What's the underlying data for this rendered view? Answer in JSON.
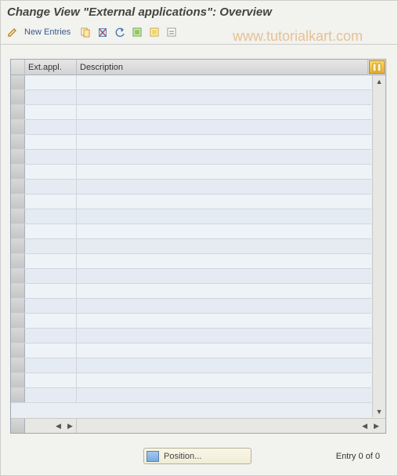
{
  "title": "Change View \"External applications\": Overview",
  "toolbar": {
    "new_entries_label": "New Entries"
  },
  "watermark": "www.tutorialkart.com",
  "table": {
    "columns": {
      "ext_appl": "Ext.appl.",
      "description": "Description"
    },
    "row_count": 22
  },
  "footer": {
    "position_label": "Position...",
    "entry_status": "Entry 0 of 0"
  }
}
